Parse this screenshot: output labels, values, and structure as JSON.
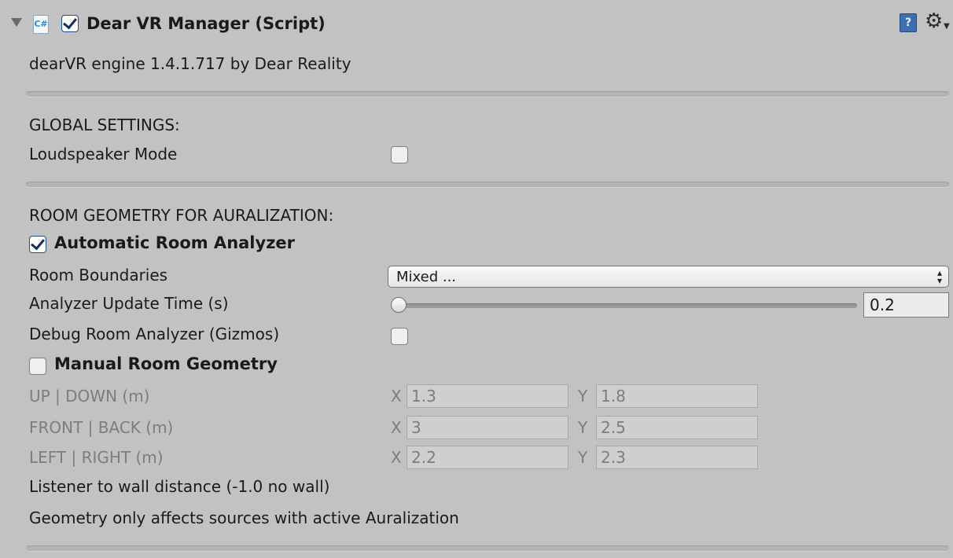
{
  "component": {
    "title": "Dear VR Manager (Script)",
    "enabled": true,
    "script_icon_text": "C#",
    "help_icon_text": "?",
    "gear_icon_text": "⚙"
  },
  "engine_info": "dearVR engine 1.4.1.717 by Dear Reality",
  "global": {
    "heading": "GLOBAL SETTINGS:",
    "loudspeaker_label": "Loudspeaker Mode",
    "loudspeaker_checked": false
  },
  "room": {
    "heading": "ROOM GEOMETRY FOR AURALIZATION:",
    "auto_analyzer_label": "Automatic Room Analyzer",
    "auto_analyzer_checked": true,
    "boundaries_label": "Room Boundaries",
    "boundaries_value": "Mixed ...",
    "update_time_label": "Analyzer Update Time (s)",
    "update_time_value": "0.2",
    "debug_label": "Debug Room Analyzer (Gizmos)",
    "debug_checked": false,
    "manual_label": "Manual Room Geometry",
    "manual_checked": false,
    "up_down": {
      "label": "UP | DOWN (m)",
      "x_label": "X",
      "x": "1.3",
      "y_label": "Y",
      "y": "1.8"
    },
    "front_back": {
      "label": "FRONT | BACK (m)",
      "x_label": "X",
      "x": "3",
      "y_label": "Y",
      "y": "2.5"
    },
    "left_right": {
      "label": "LEFT | RIGHT (m)",
      "x_label": "X",
      "x": "2.2",
      "y_label": "Y",
      "y": "2.3"
    },
    "listener_note": "Listener to wall distance (-1.0 no wall)",
    "geometry_note": "Geometry only affects sources with active Auralization"
  }
}
